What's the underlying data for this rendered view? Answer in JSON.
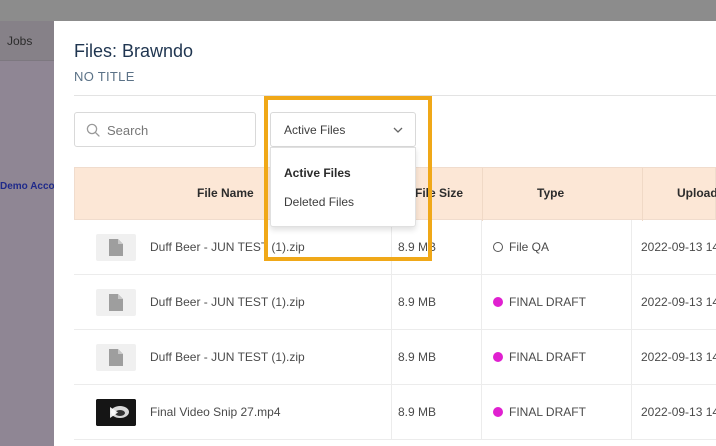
{
  "background": {
    "nav_jobs": "Jobs",
    "demo_account": "Demo Account"
  },
  "modal": {
    "title": "Files: Brawndo",
    "subtitle": "NO TITLE"
  },
  "search": {
    "placeholder": "Search",
    "icon": "search-icon"
  },
  "filter": {
    "selected": "Active Files",
    "options": [
      "Active Files",
      "Deleted Files"
    ]
  },
  "table": {
    "headers": [
      "File Name",
      "File Size",
      "Type",
      "Uploaded"
    ],
    "rows": [
      {
        "file_name": "Duff Beer - JUN TEST (1).zip",
        "size": "8.9 MB",
        "type": "File QA",
        "type_style": "outline",
        "uploaded": "2022-09-13 14",
        "thumb": "file-icon"
      },
      {
        "file_name": "Duff Beer - JUN TEST (1).zip",
        "size": "8.9 MB",
        "type": "FINAL DRAFT",
        "type_style": "filled",
        "uploaded": "2022-09-13 14",
        "thumb": "file-icon"
      },
      {
        "file_name": "Duff Beer - JUN TEST (1).zip",
        "size": "8.9 MB",
        "type": "FINAL DRAFT",
        "type_style": "filled",
        "uploaded": "2022-09-13 14",
        "thumb": "file-icon"
      },
      {
        "file_name": "Final Video Snip 27.mp4",
        "size": "8.9 MB",
        "type": "FINAL DRAFT",
        "type_style": "filled",
        "uploaded": "2022-09-13 14",
        "thumb": "video-thumbnail"
      }
    ]
  },
  "colors": {
    "header_bg": "#fce7d6",
    "highlight": "#f0a818",
    "final_draft_dot": "#e020d0"
  }
}
